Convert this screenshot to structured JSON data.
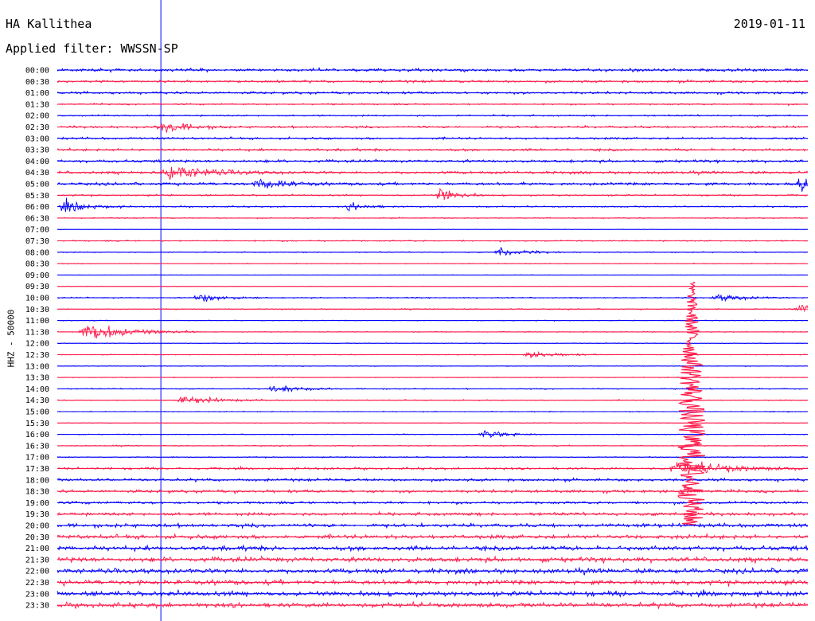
{
  "header": {
    "station": "HA Kallithea",
    "date": "2019-01-11",
    "filter": "Applied filter: WWSSN-SP"
  },
  "chart_data": {
    "type": "line",
    "title": "HA Kallithea",
    "subtitle": "Applied filter: WWSSN-SP",
    "ylabel": "HHZ - 50000",
    "xlabel": "",
    "colors": [
      "#0000ff",
      "#ff1a4a"
    ],
    "grid": false,
    "rows": [
      {
        "label": "00:00",
        "activity": 0.55,
        "color": "#0000ff"
      },
      {
        "label": "00:30",
        "activity": 0.45,
        "color": "#ff1a4a"
      },
      {
        "label": "01:00",
        "activity": 0.45,
        "color": "#0000ff"
      },
      {
        "label": "01:30",
        "activity": 0.3,
        "color": "#ff1a4a"
      },
      {
        "label": "02:00",
        "activity": 0.3,
        "color": "#0000ff"
      },
      {
        "label": "02:30",
        "activity": 0.4,
        "color": "#ff1a4a"
      },
      {
        "label": "03:00",
        "activity": 0.4,
        "color": "#0000ff"
      },
      {
        "label": "03:30",
        "activity": 0.45,
        "color": "#ff1a4a"
      },
      {
        "label": "04:00",
        "activity": 0.5,
        "color": "#0000ff"
      },
      {
        "label": "04:30",
        "activity": 0.5,
        "color": "#ff1a4a"
      },
      {
        "label": "05:00",
        "activity": 0.5,
        "color": "#0000ff"
      },
      {
        "label": "05:30",
        "activity": 0.3,
        "color": "#ff1a4a"
      },
      {
        "label": "06:00",
        "activity": 0.25,
        "color": "#0000ff"
      },
      {
        "label": "06:30",
        "activity": 0.2,
        "color": "#ff1a4a"
      },
      {
        "label": "07:00",
        "activity": 0.1,
        "color": "#0000ff"
      },
      {
        "label": "07:30",
        "activity": 0.25,
        "color": "#ff1a4a"
      },
      {
        "label": "08:00",
        "activity": 0.2,
        "color": "#0000ff"
      },
      {
        "label": "08:30",
        "activity": 0.15,
        "color": "#ff1a4a"
      },
      {
        "label": "09:00",
        "activity": 0.1,
        "color": "#0000ff"
      },
      {
        "label": "09:30",
        "activity": 0.1,
        "color": "#ff1a4a"
      },
      {
        "label": "10:00",
        "activity": 0.2,
        "color": "#0000ff"
      },
      {
        "label": "10:30",
        "activity": 0.2,
        "color": "#ff1a4a"
      },
      {
        "label": "11:00",
        "activity": 0.15,
        "color": "#0000ff"
      },
      {
        "label": "11:30",
        "activity": 0.15,
        "color": "#ff1a4a"
      },
      {
        "label": "12:00",
        "activity": 0.15,
        "color": "#0000ff"
      },
      {
        "label": "12:30",
        "activity": 0.15,
        "color": "#ff1a4a"
      },
      {
        "label": "13:00",
        "activity": 0.15,
        "color": "#0000ff"
      },
      {
        "label": "13:30",
        "activity": 0.15,
        "color": "#ff1a4a"
      },
      {
        "label": "14:00",
        "activity": 0.2,
        "color": "#0000ff"
      },
      {
        "label": "14:30",
        "activity": 0.2,
        "color": "#ff1a4a"
      },
      {
        "label": "15:00",
        "activity": 0.15,
        "color": "#0000ff"
      },
      {
        "label": "15:30",
        "activity": 0.15,
        "color": "#ff1a4a"
      },
      {
        "label": "16:00",
        "activity": 0.15,
        "color": "#0000ff"
      },
      {
        "label": "16:30",
        "activity": 0.2,
        "color": "#ff1a4a"
      },
      {
        "label": "17:00",
        "activity": 0.2,
        "color": "#0000ff"
      },
      {
        "label": "17:30",
        "activity": 0.4,
        "color": "#ff1a4a"
      },
      {
        "label": "18:00",
        "activity": 0.5,
        "color": "#0000ff"
      },
      {
        "label": "18:30",
        "activity": 0.55,
        "color": "#ff1a4a"
      },
      {
        "label": "19:00",
        "activity": 0.5,
        "color": "#0000ff"
      },
      {
        "label": "19:30",
        "activity": 0.6,
        "color": "#ff1a4a"
      },
      {
        "label": "20:00",
        "activity": 0.7,
        "color": "#0000ff"
      },
      {
        "label": "20:30",
        "activity": 0.75,
        "color": "#ff1a4a"
      },
      {
        "label": "21:00",
        "activity": 0.85,
        "color": "#0000ff"
      },
      {
        "label": "21:30",
        "activity": 0.9,
        "color": "#ff1a4a"
      },
      {
        "label": "22:00",
        "activity": 0.9,
        "color": "#0000ff"
      },
      {
        "label": "22:30",
        "activity": 0.9,
        "color": "#ff1a4a"
      },
      {
        "label": "23:00",
        "activity": 0.9,
        "color": "#0000ff"
      },
      {
        "label": "23:30",
        "activity": 0.85,
        "color": "#ff1a4a"
      }
    ],
    "events": [
      {
        "row": "02:30",
        "x": 0.14,
        "amp": 1.4,
        "len": 0.03
      },
      {
        "row": "04:30",
        "x": 0.15,
        "amp": 1.5,
        "len": 0.05
      },
      {
        "row": "05:00",
        "x": 0.27,
        "amp": 1.3,
        "len": 0.03
      },
      {
        "row": "05:30",
        "x": 0.51,
        "amp": 1.6,
        "len": 0.02
      },
      {
        "row": "05:00",
        "x": 0.99,
        "amp": 1.5,
        "len": 0.03
      },
      {
        "row": "06:00",
        "x": 0.01,
        "amp": 1.2,
        "len": 0.03
      },
      {
        "row": "06:00",
        "x": 0.39,
        "amp": 1.1,
        "len": 0.02
      },
      {
        "row": "08:00",
        "x": 0.59,
        "amp": 1.0,
        "len": 0.03
      },
      {
        "row": "10:00",
        "x": 0.19,
        "amp": 1.0,
        "len": 0.03
      },
      {
        "row": "10:00",
        "x": 0.88,
        "amp": 0.9,
        "len": 0.03
      },
      {
        "row": "10:30",
        "x": 0.99,
        "amp": 1.1,
        "len": 0.03
      },
      {
        "row": "11:30",
        "x": 0.04,
        "amp": 2.2,
        "len": 0.05
      },
      {
        "row": "12:30",
        "x": 0.63,
        "amp": 0.9,
        "len": 0.03
      },
      {
        "row": "14:00",
        "x": 0.29,
        "amp": 1.0,
        "len": 0.03
      },
      {
        "row": "14:30",
        "x": 0.17,
        "amp": 0.9,
        "len": 0.04
      },
      {
        "row": "16:00",
        "x": 0.57,
        "amp": 0.9,
        "len": 0.03
      },
      {
        "row": "17:30",
        "x": 0.83,
        "amp": 1.6,
        "len": 0.06
      }
    ],
    "major_event": {
      "row": "10:00",
      "x": 0.845,
      "rows_spanned": 20,
      "label": ""
    },
    "time_marker": {
      "x": 0.138
    }
  }
}
